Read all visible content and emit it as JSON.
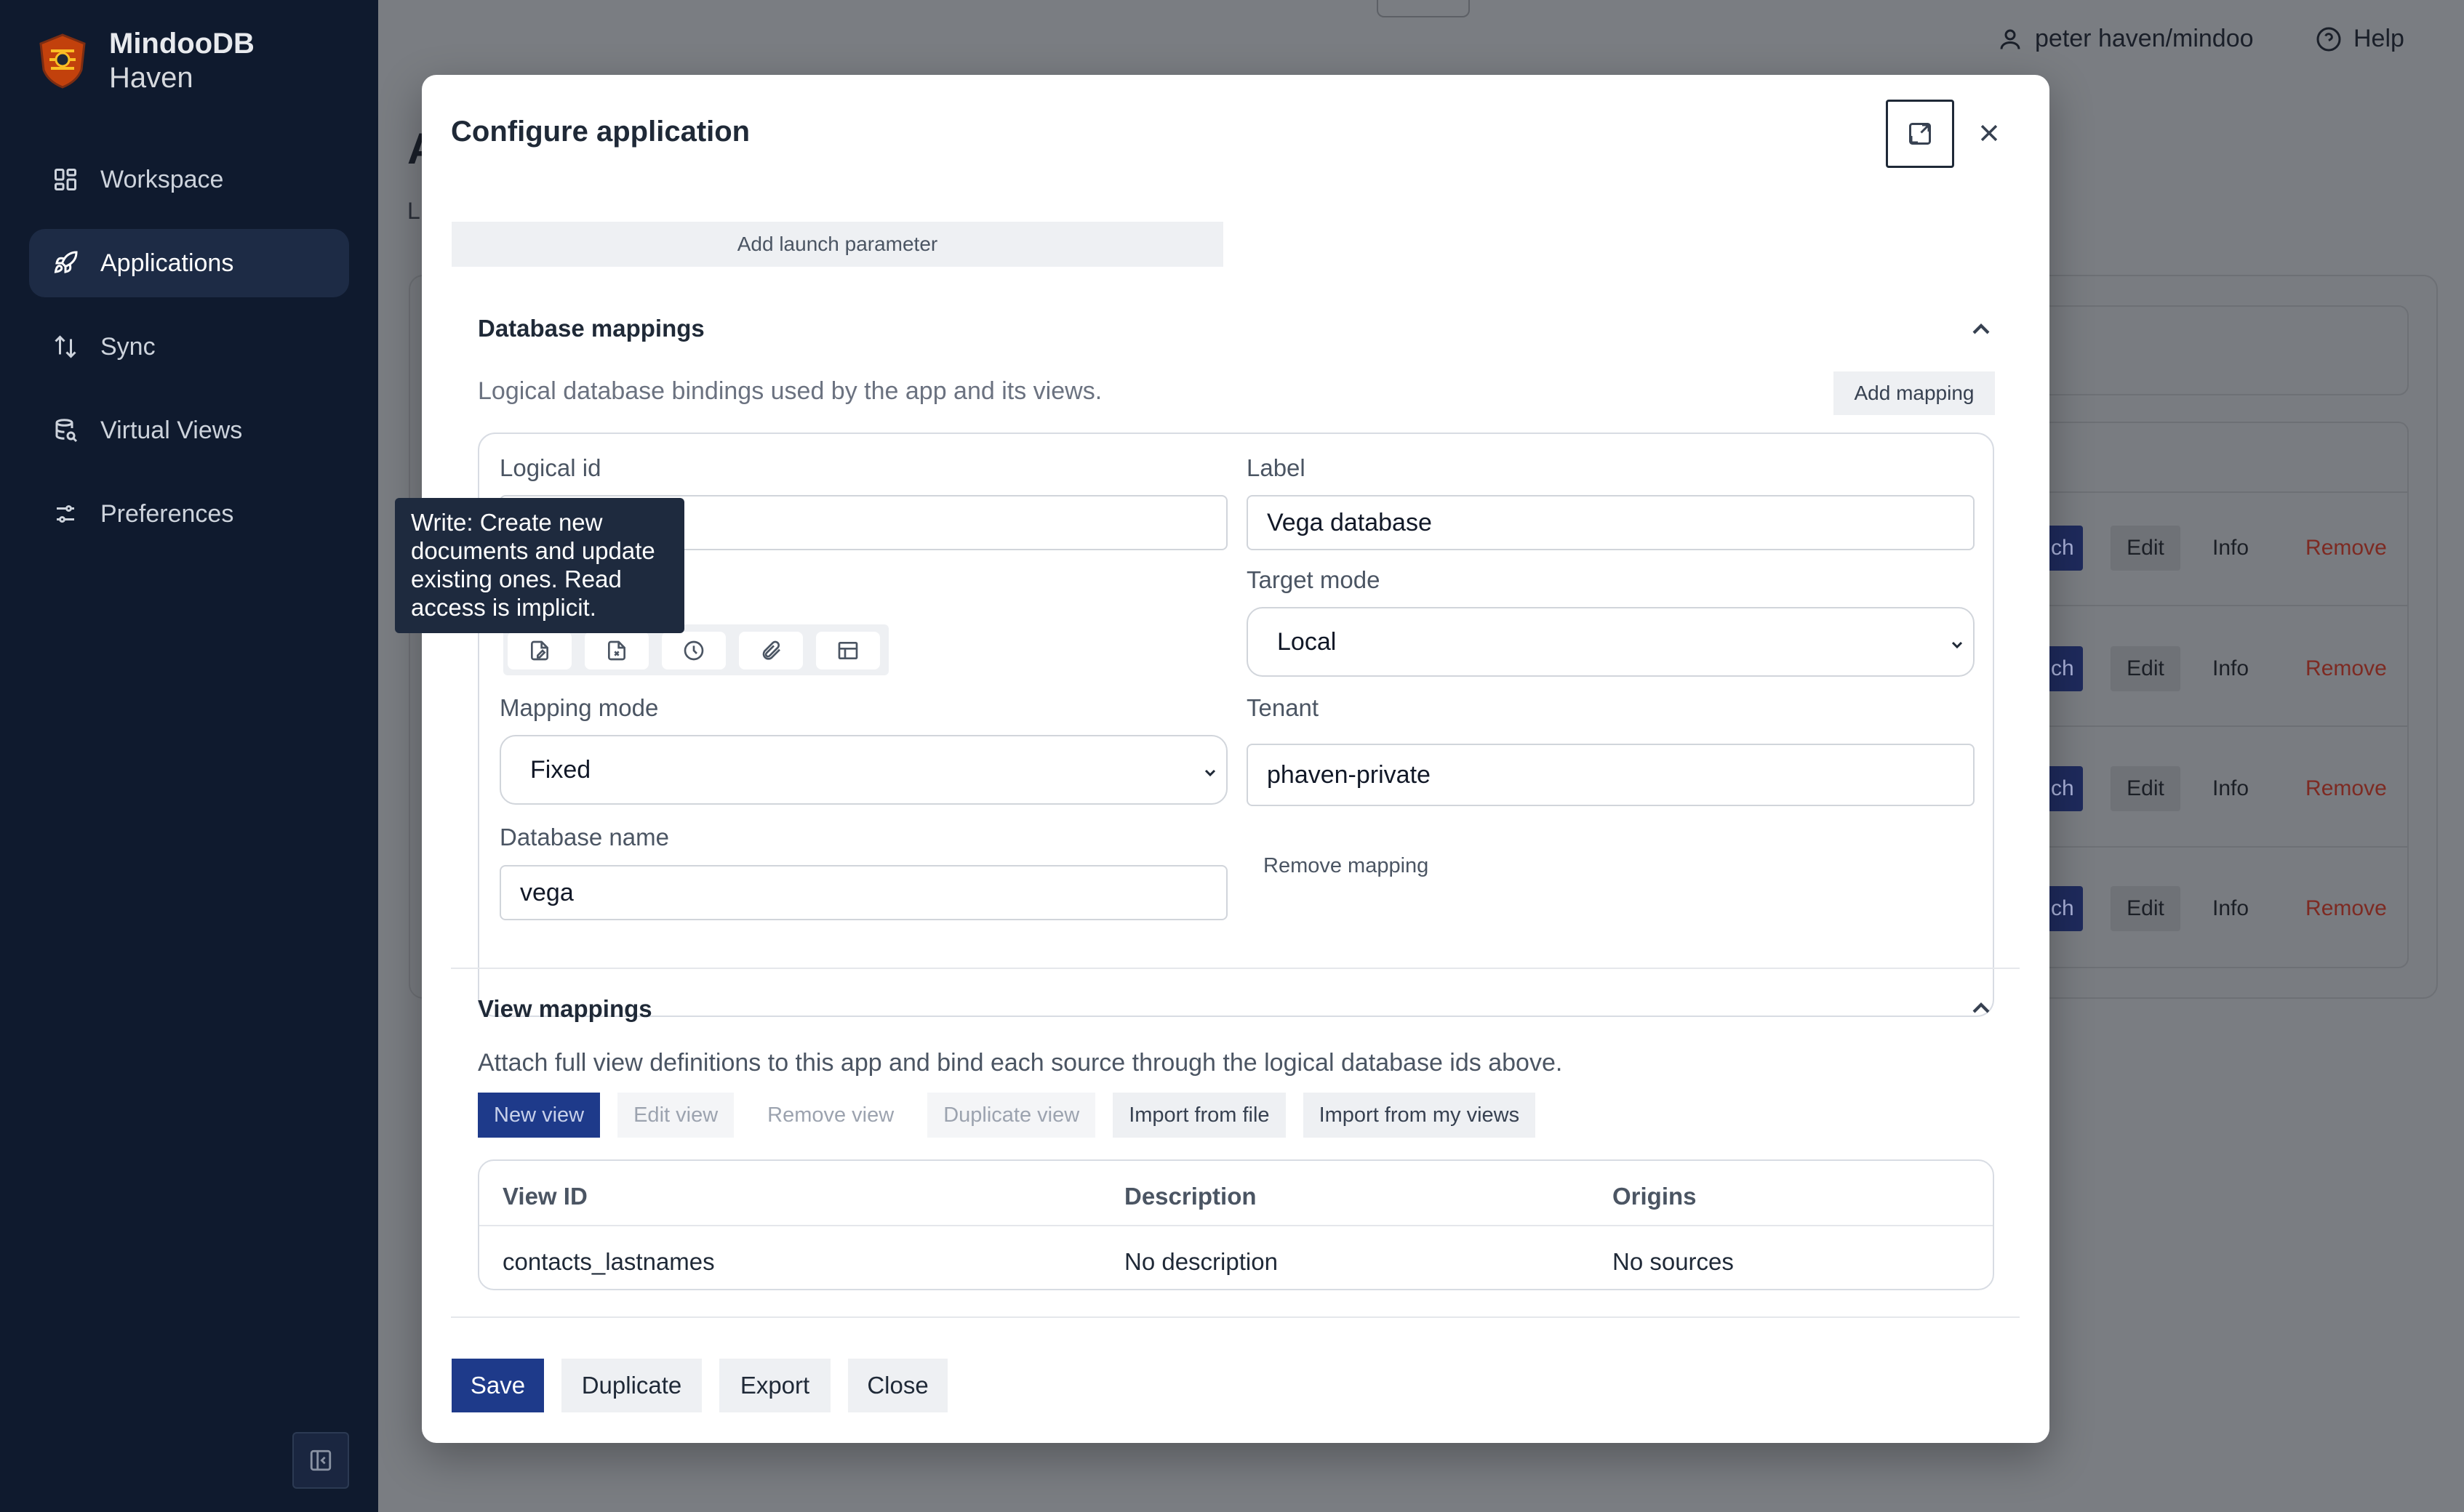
{
  "app": {
    "brand_line1": "MindooDB",
    "brand_line2": "Haven"
  },
  "sidebar": {
    "items": [
      {
        "label": "Workspace",
        "icon": "grid-icon"
      },
      {
        "label": "Applications",
        "icon": "rocket-icon",
        "active": true
      },
      {
        "label": "Sync",
        "icon": "sync-arrows-icon"
      },
      {
        "label": "Virtual Views",
        "icon": "database-view-icon"
      },
      {
        "label": "Preferences",
        "icon": "sliders-icon"
      }
    ]
  },
  "topbar": {
    "user": "peter haven/mindoo",
    "help": "Help"
  },
  "background": {
    "title": "A",
    "subtitle": "L",
    "rows": [
      {
        "launch": "ch",
        "edit": "Edit",
        "info": "Info",
        "remove": "Remove"
      },
      {
        "launch": "ch",
        "edit": "Edit",
        "info": "Info",
        "remove": "Remove"
      },
      {
        "launch": "ch",
        "edit": "Edit",
        "info": "Info",
        "remove": "Remove"
      },
      {
        "launch": "ch",
        "edit": "Edit",
        "info": "Info",
        "remove": "Remove"
      }
    ]
  },
  "modal": {
    "title": "Configure application",
    "add_launch_parameter": "Add launch parameter",
    "database_mappings": {
      "heading": "Database mappings",
      "description": "Logical database bindings used by the app and its views.",
      "add_mapping": "Add mapping",
      "logical_id_label": "Logical id",
      "logical_id_value": "",
      "label_label": "Label",
      "label_value": "Vega database",
      "target_mode_label": "Target mode",
      "target_mode_value": "Local",
      "mapping_mode_label": "Mapping mode",
      "mapping_mode_value": "Fixed",
      "tenant_label": "Tenant",
      "tenant_value": "phaven-private",
      "database_name_label": "Database name",
      "database_name_value": "vega",
      "remove_mapping": "Remove mapping",
      "tooltip": "Write: Create new documents and update existing ones. Read access is implicit."
    },
    "view_mappings": {
      "heading": "View mappings",
      "description": "Attach full view definitions to this app and bind each source through the logical database ids above.",
      "buttons": {
        "new_view": "New view",
        "edit_view": "Edit view",
        "remove_view": "Remove view",
        "duplicate_view": "Duplicate view",
        "import_from_file": "Import from file",
        "import_from_my_views": "Import from my views"
      },
      "columns": [
        "View ID",
        "Description",
        "Origins"
      ],
      "rows": [
        {
          "view_id": "contacts_lastnames",
          "description": "No description",
          "origins": "No sources"
        }
      ]
    },
    "footer": {
      "save": "Save",
      "duplicate": "Duplicate",
      "export": "Export",
      "close": "Close"
    }
  }
}
